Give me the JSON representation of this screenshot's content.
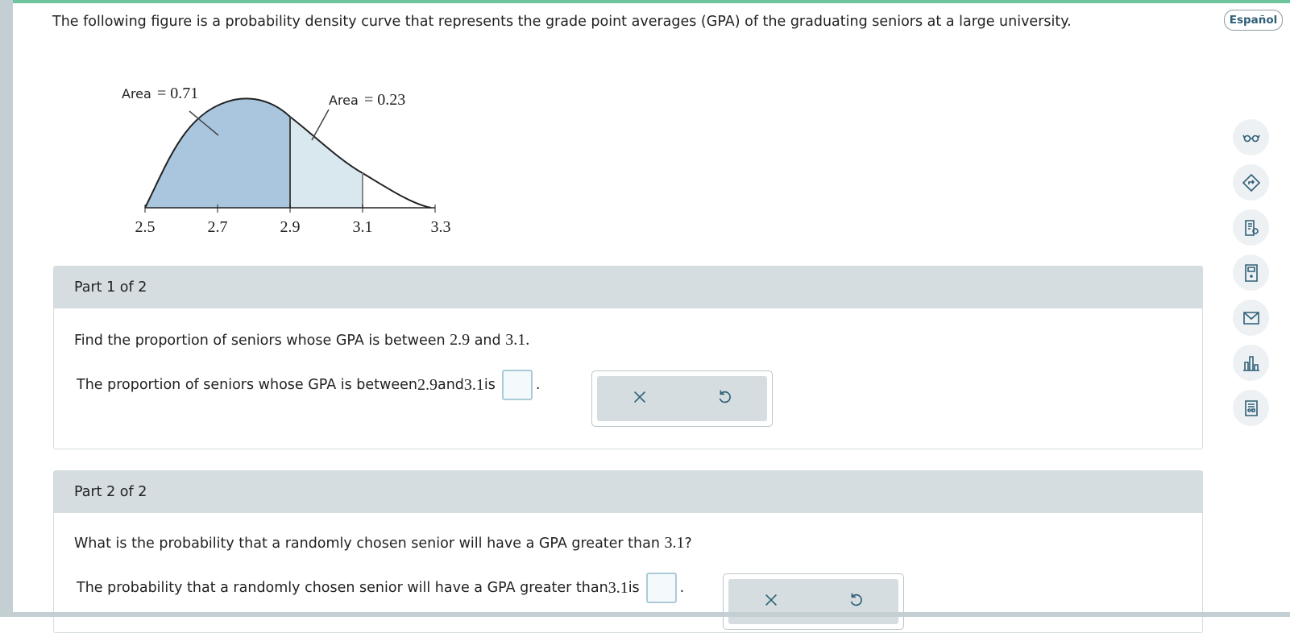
{
  "header": {
    "intro_text": "The following figure is a probability density curve that represents the grade point averages (GPA) of the graduating seniors at a large university.",
    "language_button": "Español"
  },
  "figure": {
    "area_word": "Area",
    "area_left_value": "= 0.71",
    "area_right_value": "= 0.23",
    "x_ticks": [
      "2.5",
      "2.7",
      "2.9",
      "3.1",
      "3.3"
    ]
  },
  "sidebar_tools": [
    {
      "icon": "glasses-icon"
    },
    {
      "icon": "directions-icon"
    },
    {
      "icon": "textbook-icon"
    },
    {
      "icon": "calculator-icon"
    },
    {
      "icon": "mail-icon"
    },
    {
      "icon": "bar-chart-icon"
    },
    {
      "icon": "data-table-icon"
    }
  ],
  "parts": [
    {
      "header": "Part 1 of 2",
      "question_prefix": "Find the proportion of seniors whose GPA is between ",
      "q_num1": "2.9",
      "q_mid": " and ",
      "q_num2": "3.1",
      "q_suffix": ".",
      "answer_prefix": "The proportion of seniors whose GPA is between ",
      "a_num1": "2.9",
      "a_mid": " and ",
      "a_num2": "3.1",
      "a_suffix": " is",
      "answer_value": "",
      "clear_icon": "x-icon",
      "undo_icon": "undo-icon"
    },
    {
      "header": "Part 2 of 2",
      "question_prefix": "What is the probability that a randomly chosen senior will have a GPA greater than ",
      "q_num1": "3.1",
      "q_suffix": "?",
      "answer_prefix": "The probability that a randomly chosen senior will have a GPA greater than ",
      "a_num1": "3.1",
      "a_suffix": " is",
      "answer_value": "",
      "clear_icon": "x-icon",
      "undo_icon": "undo-icon"
    }
  ],
  "colors": {
    "accent_green": "#6cc49d",
    "dark_shade": "#a9c6de",
    "light_shade": "#d9e7ef",
    "part_header_bg": "#d5dde0",
    "icon_teal": "#2f5f77"
  }
}
